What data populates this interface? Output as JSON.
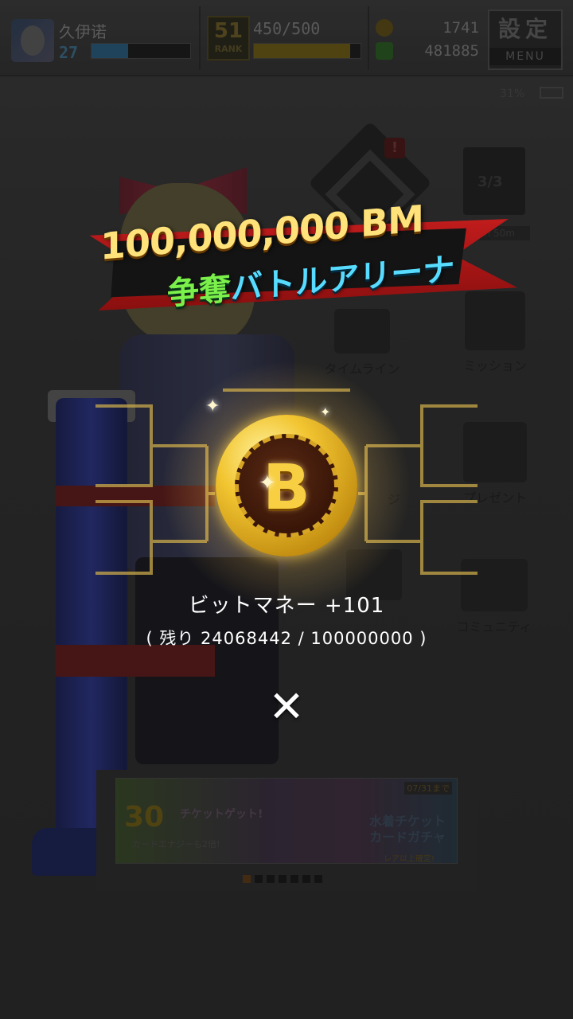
{
  "hud": {
    "player_name": "久伊诺",
    "level": "27",
    "exp_progress": 0.37,
    "rank_number": "51",
    "rank_label": "RANK",
    "stamina": "450/500",
    "stamina_progress": 0.9,
    "coins": "1741",
    "money": "481885",
    "settings_kanji": "設定",
    "menu_label": "MENU",
    "battery": "31%"
  },
  "menu": {
    "page_counter": "3/3",
    "timer": "1h 50m",
    "alert": "!",
    "timeline": "タイムライン",
    "mission": "ミッション",
    "present": "プレゼント",
    "community": "コミュニティ",
    "partial_label": "ジ"
  },
  "banner": {
    "big_number": "30",
    "left_text": "チケットゲット!",
    "left_subtext": "カードエナジーも2倍!",
    "date": "07/31まで",
    "right_text_1": "水着チケット",
    "right_text_2": "カードガチャ",
    "right_subtext": "レア以上確定!",
    "dots_total": 7,
    "dots_active_index": 0
  },
  "event": {
    "title_line1": "100,000,000 BM",
    "title_line2_part1": "争奪",
    "title_line2_part2": "バトルアリーナ",
    "coin_symbol": "B",
    "reward_text": "ビットマネー +101",
    "remaining_text": "( 残り 24068442 / 100000000 )",
    "close_symbol": "✕"
  },
  "colors": {
    "title_gold": "#ffe27a",
    "title_green": "#7cf04a",
    "title_cyan": "#57dcff",
    "ribbon_red": "#c11c1c",
    "coin_gold": "#f2c531"
  }
}
